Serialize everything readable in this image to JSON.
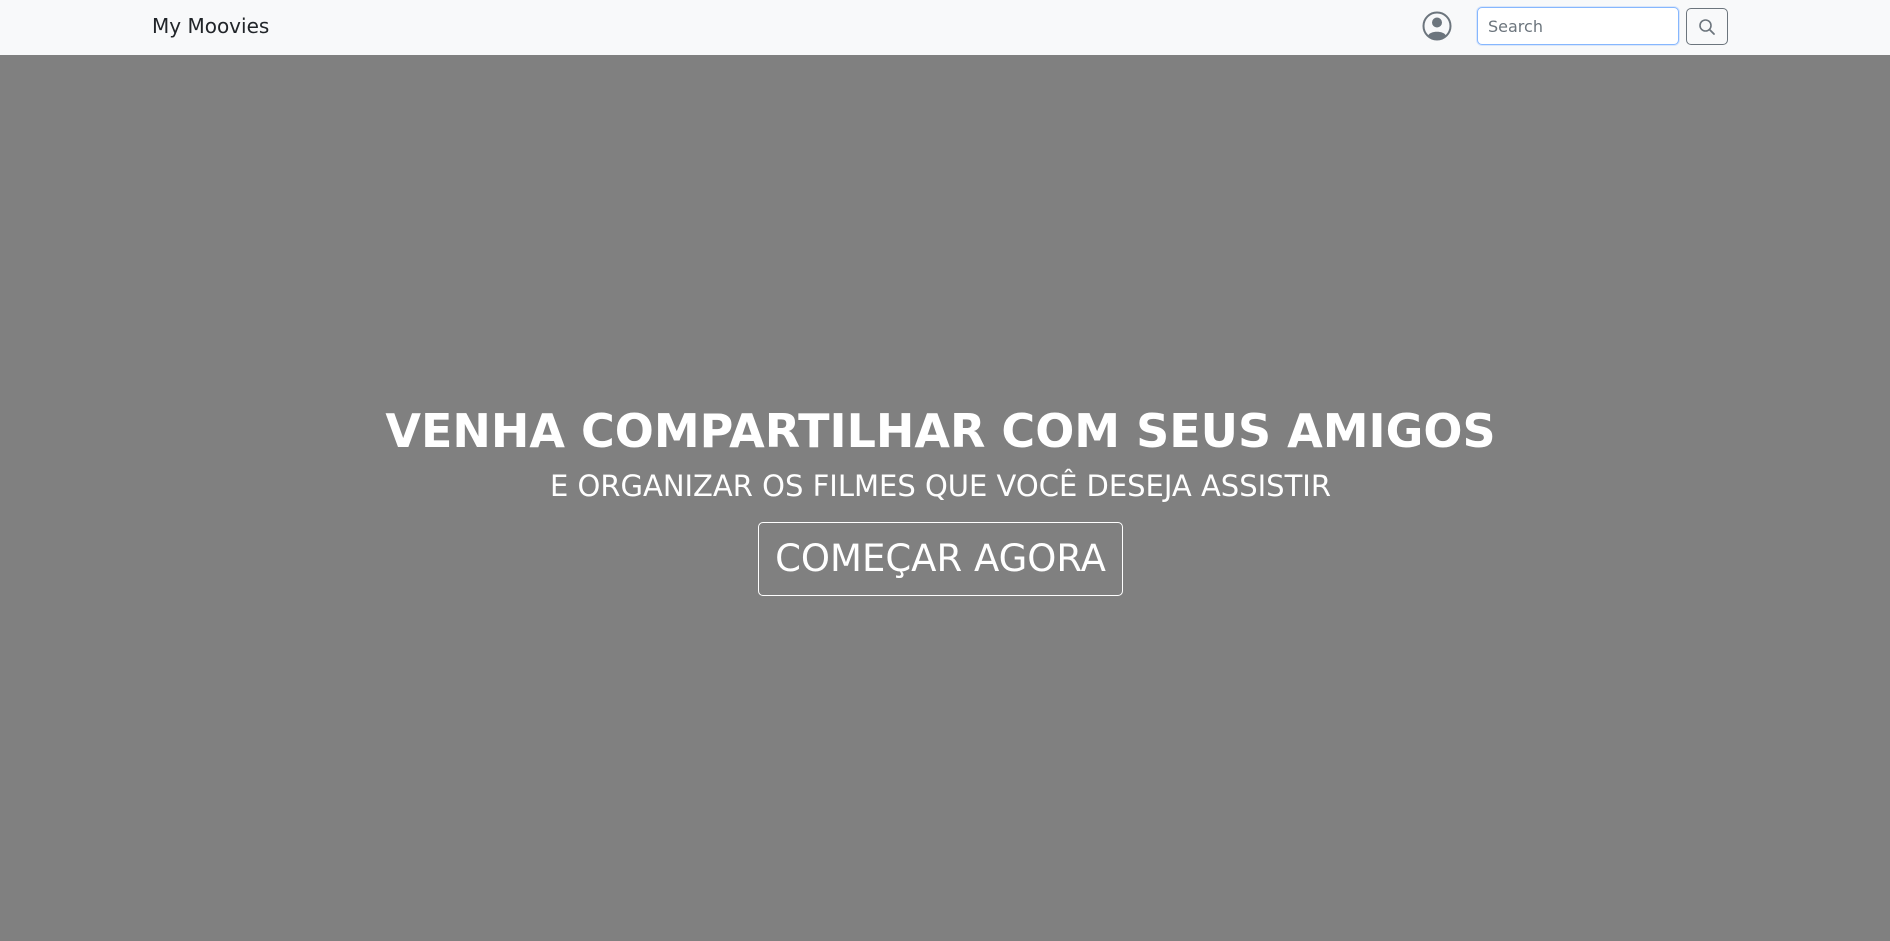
{
  "navbar": {
    "brand": "My Moovies",
    "user_icon": "user-circle-icon",
    "search": {
      "placeholder": "Search",
      "value": ""
    },
    "search_button_icon": "search-icon"
  },
  "hero": {
    "title": "VENHA COMPARTILHAR COM SEUS AMIGOS",
    "subtitle": "E ORGANIZAR OS FILMES QUE VOCÊ DESEJA ASSISTIR",
    "cta_label": "COMEÇAR AGORA"
  },
  "colors": {
    "navbar_bg": "#f8f9fa",
    "hero_bg": "#808080",
    "hero_text": "#ffffff",
    "input_focus_border": "#86b7fe",
    "button_border": "#6c757d"
  }
}
